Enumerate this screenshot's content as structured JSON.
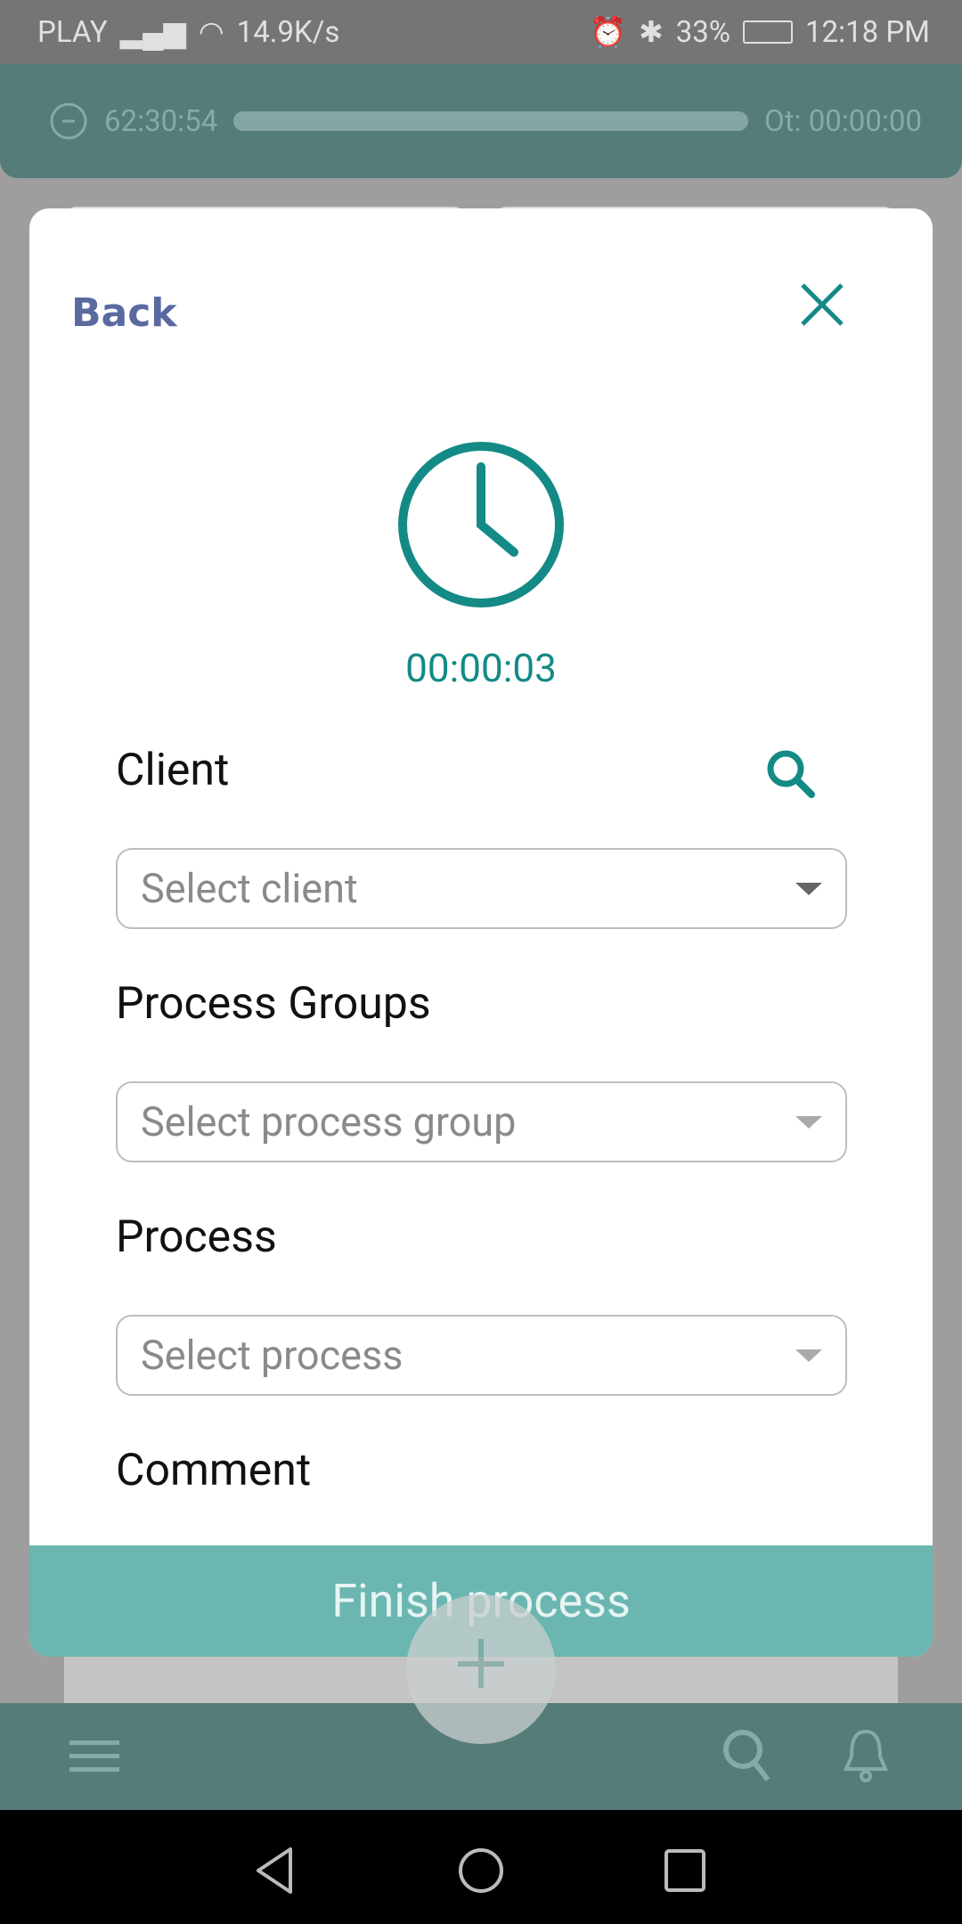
{
  "status_bar": {
    "carrier": "PLAY",
    "net_speed": "14.9K/s",
    "battery": "33%",
    "time": "12:18 PM"
  },
  "header": {
    "elapsed": "62:30:54",
    "overtime": "Ot: 00:00:00"
  },
  "modal": {
    "back_label": "Back",
    "timer": "00:00:03",
    "client": {
      "label": "Client",
      "placeholder": "Select client"
    },
    "process_groups": {
      "label": "Process Groups",
      "placeholder": "Select process group"
    },
    "process": {
      "label": "Process",
      "placeholder": "Select process"
    },
    "comment": {
      "label": "Comment"
    },
    "finish_label": "Finish process"
  },
  "colors": {
    "accent": "#138a85",
    "button": "#6bb6b0",
    "header": "#557c79",
    "back": "#5a6aa0"
  }
}
